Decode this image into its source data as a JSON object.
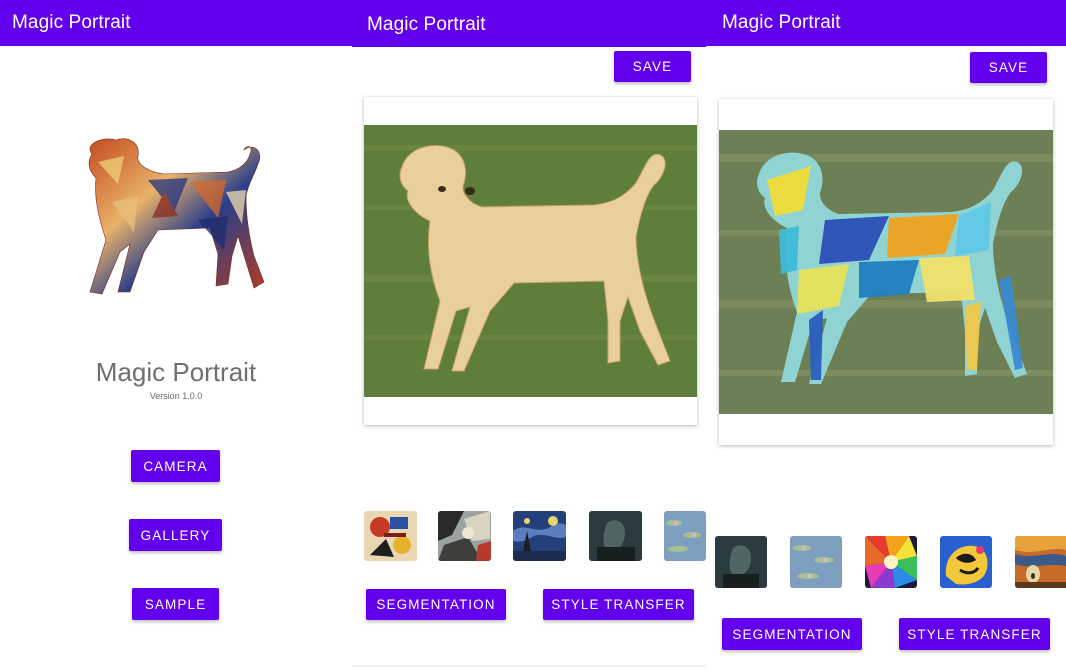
{
  "colors": {
    "primary": "#6200ee",
    "on_primary": "#ffffff",
    "background": "#ffffff"
  },
  "home_screen": {
    "app_bar_title": "Magic Portrait",
    "logo_icon": "stylized-dog-icon",
    "app_name": "Magic Portrait",
    "version": "Version 1.0.0",
    "buttons": {
      "camera": "CAMERA",
      "gallery": "GALLERY",
      "sample": "SAMPLE"
    }
  },
  "segmentation_screen": {
    "app_bar_title": "Magic Portrait",
    "save_label": "SAVE",
    "photo_icon": "labrador-photo",
    "style_thumbnails": [
      "kandinsky-style",
      "picasso-style",
      "starry-night-style",
      "dark-portrait-style",
      "water-lilies-style"
    ],
    "segmentation_label": "SEGMENTATION",
    "style_transfer_label": "STYLE TRANSFER"
  },
  "style_transfer_screen": {
    "app_bar_title": "Magic Portrait",
    "save_label": "SAVE",
    "photo_icon": "stylized-labrador-photo",
    "style_thumbnails": [
      "dark-portrait-style",
      "water-lilies-style",
      "color-burst-style",
      "pop-art-style",
      "the-scream-style"
    ],
    "segmentation_label": "SEGMENTATION",
    "style_transfer_label": "STYLE TRANSFER"
  }
}
